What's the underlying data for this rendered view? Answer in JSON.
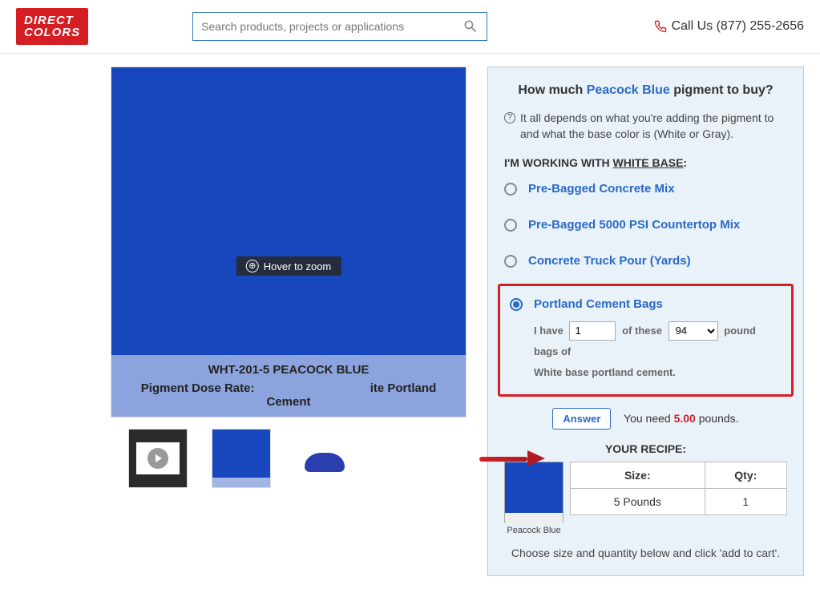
{
  "header": {
    "logo_line1": "DIRECT",
    "logo_line2": "COLORS",
    "search_placeholder": "Search products, projects or applications",
    "call_label": "Call Us (877) 255-2656"
  },
  "product": {
    "title": "WHT-201-5 PEACOCK BLUE",
    "dose_rate_prefix": "Pigment Dose Rate: ",
    "dose_rate_suffix": "ite Portland Cement",
    "hover_zoom": "Hover to zoom"
  },
  "panel": {
    "q_prefix": "How much ",
    "q_color": "Peacock Blue",
    "q_suffix": " pigment to buy?",
    "info_text": "It all depends on what you're adding the pigment to and what the base color is (White or Gray).",
    "working_prefix": "I'M WORKING WITH ",
    "working_base": "WHITE BASE",
    "working_suffix": ":",
    "options": {
      "opt1": "Pre-Bagged Concrete Mix",
      "opt2": "Pre-Bagged 5000 PSI Countertop Mix",
      "opt3": "Concrete Truck Pour (Yards)",
      "opt4": "Portland Cement Bags"
    },
    "details": {
      "i_have": "I have",
      "qty_value": "1",
      "of_these": "of these",
      "weight_value": "94",
      "pound_bags_of": "pound bags of",
      "base_line": "White base portland cement."
    },
    "answer_btn": "Answer",
    "answer_prefix": "You need ",
    "answer_amount": "5.00",
    "answer_unit": " pounds.",
    "recipe_title": "YOUR RECIPE:",
    "swatch_name": "Peacock Blue",
    "table": {
      "size_h": "Size:",
      "qty_h": "Qty:",
      "size_v": "5 Pounds",
      "qty_v": "1"
    },
    "choose_line": "Choose size and quantity below and click 'add to cart'."
  }
}
